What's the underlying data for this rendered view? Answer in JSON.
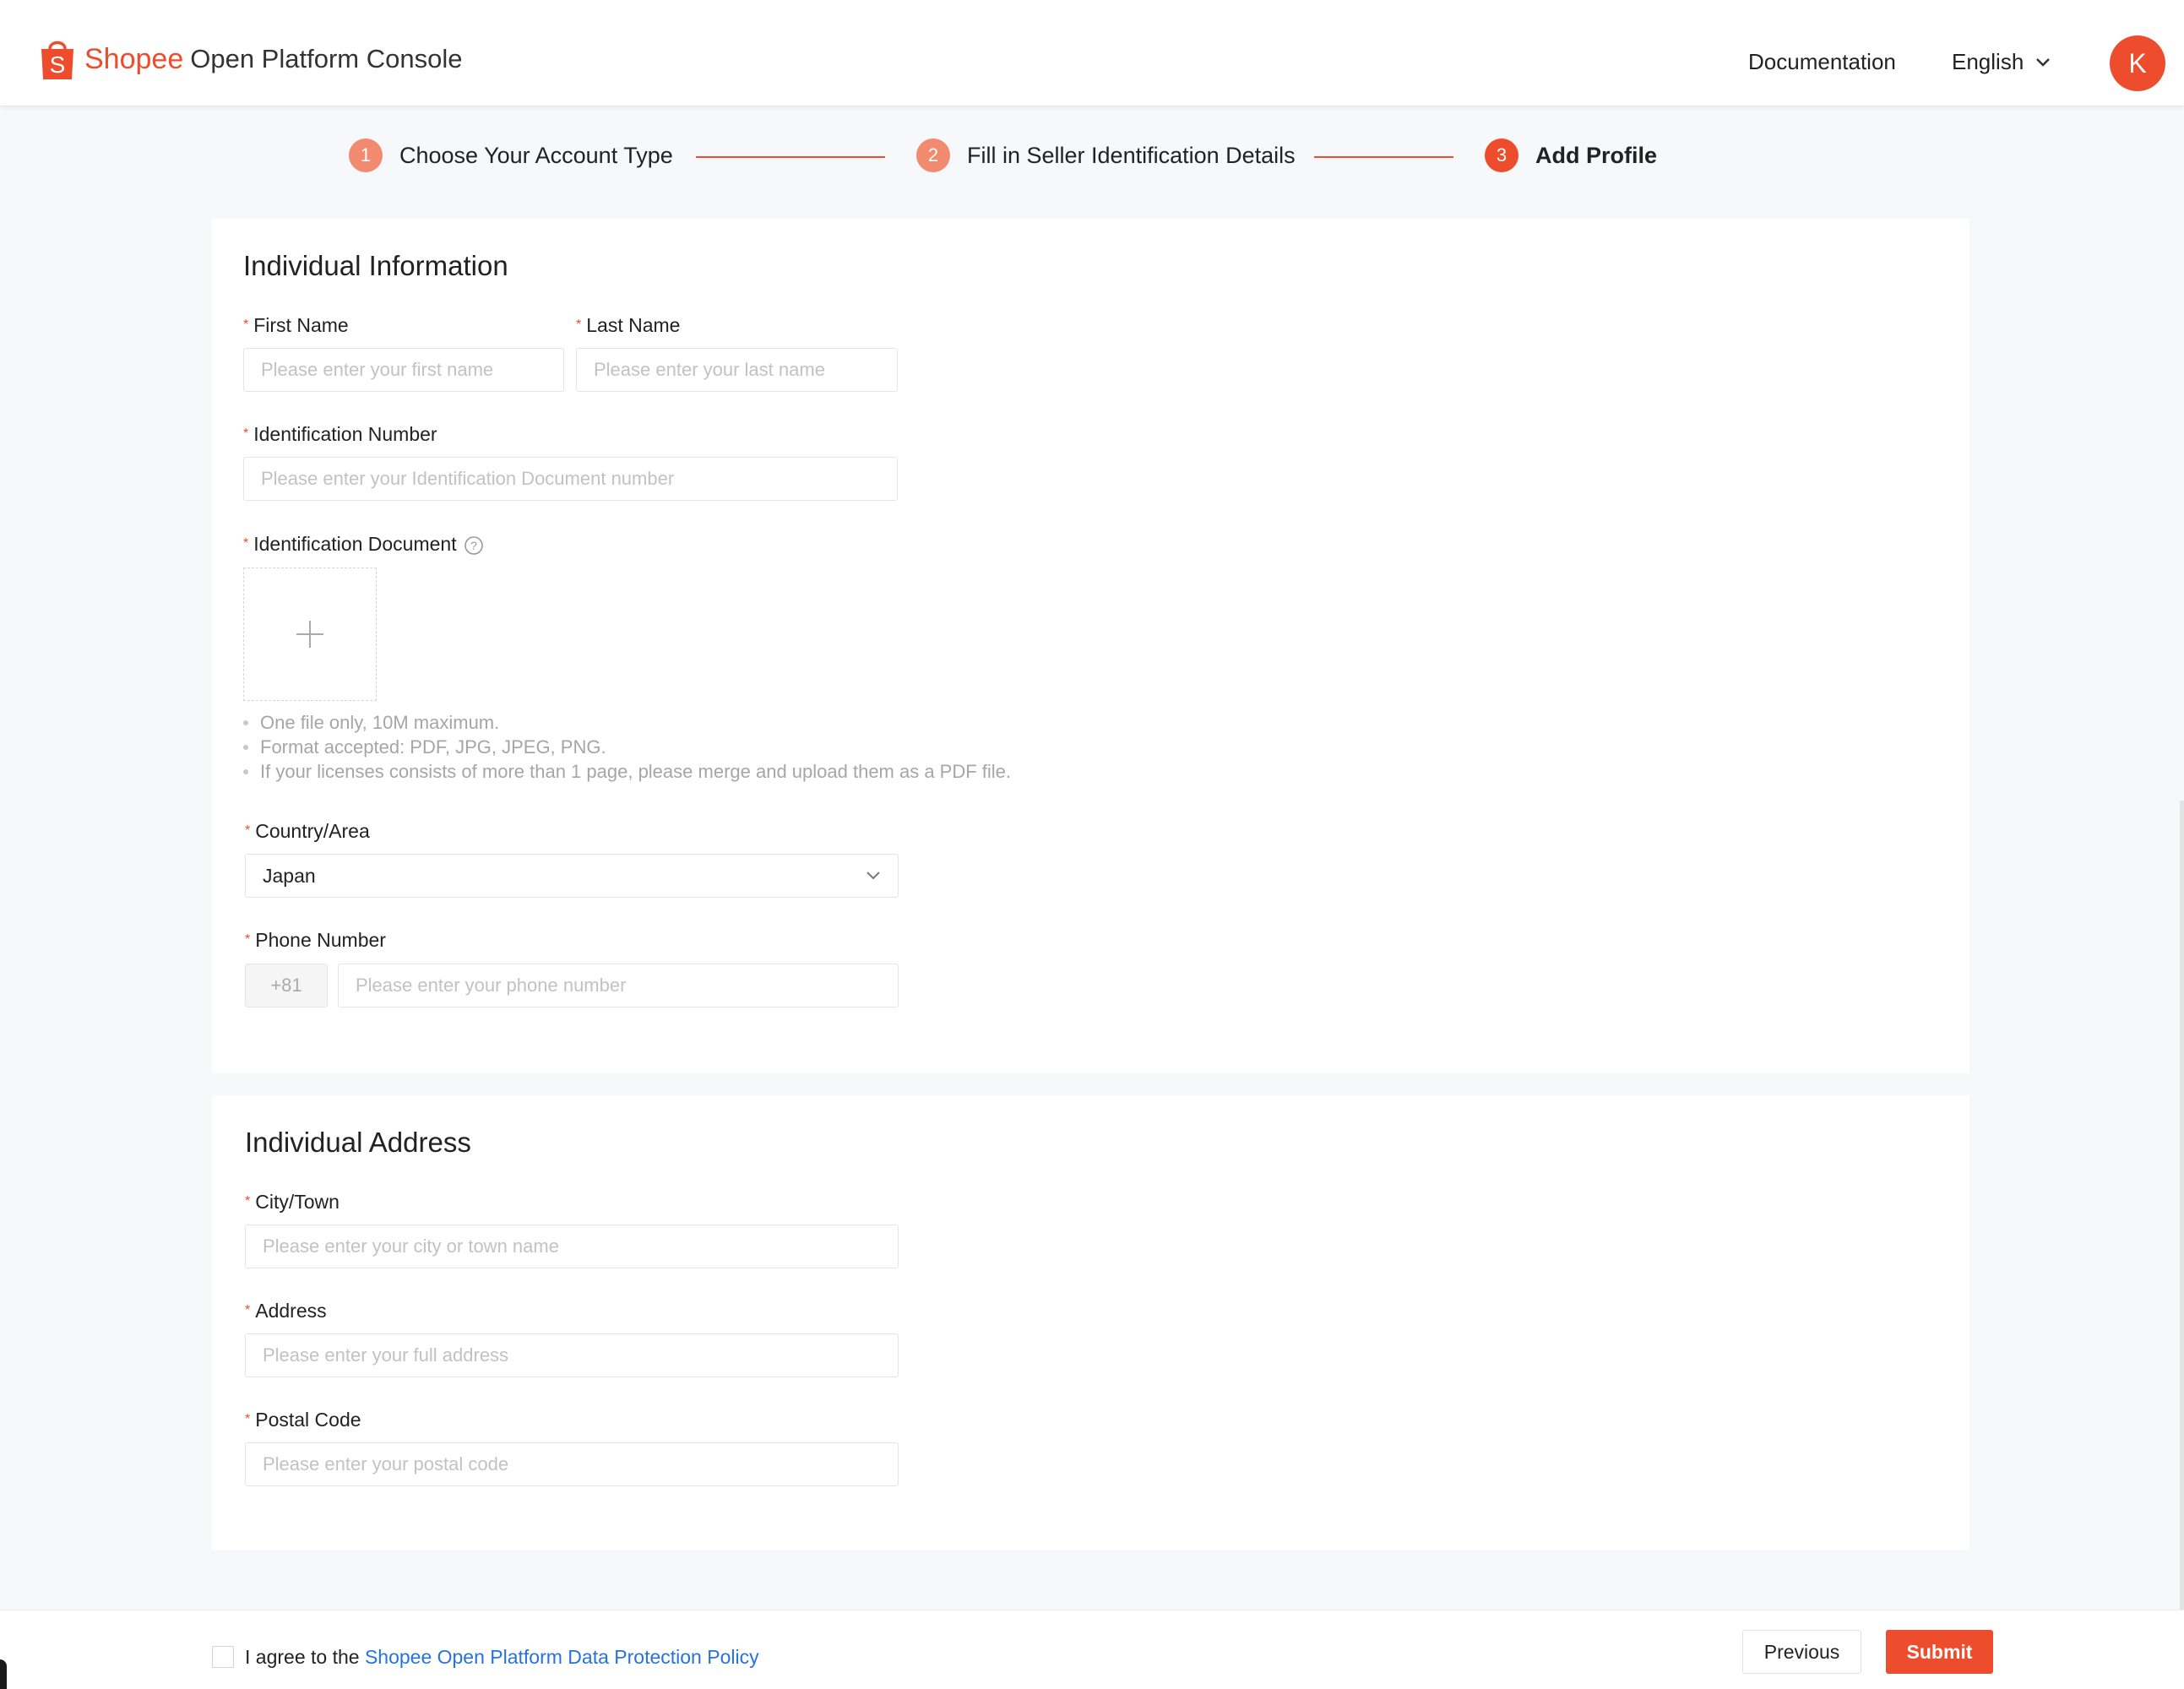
{
  "header": {
    "brand": "Shopee",
    "product": "Open Platform Console",
    "documentation": "Documentation",
    "language": "English",
    "avatar_initial": "K"
  },
  "stepper": {
    "steps": [
      {
        "number": "1",
        "label": "Choose Your Account Type"
      },
      {
        "number": "2",
        "label": "Fill in Seller Identification Details"
      },
      {
        "number": "3",
        "label": "Add Profile"
      }
    ],
    "current_step": 3
  },
  "individual_information": {
    "title": "Individual Information",
    "first_name": {
      "label": "First Name",
      "placeholder": "Please enter your first name",
      "value": ""
    },
    "last_name": {
      "label": "Last Name",
      "placeholder": "Please enter your last name",
      "value": ""
    },
    "id_number": {
      "label": "Identification Number",
      "placeholder": "Please enter your Identification Document number",
      "value": ""
    },
    "id_document": {
      "label": "Identification Document",
      "hints": [
        "One file only, 10M maximum.",
        "Format accepted: PDF, JPG, JPEG, PNG.",
        "If your licenses consists of more than 1 page, please merge and upload them as a PDF file."
      ]
    },
    "country": {
      "label": "Country/Area",
      "value": "Japan"
    },
    "phone": {
      "label": "Phone Number",
      "prefix": "+81",
      "placeholder": "Please enter your phone number",
      "value": ""
    }
  },
  "individual_address": {
    "title": "Individual Address",
    "city": {
      "label": "City/Town",
      "placeholder": "Please enter your city or town name",
      "value": ""
    },
    "address": {
      "label": "Address",
      "placeholder": "Please enter your full address",
      "value": ""
    },
    "postal_code": {
      "label": "Postal Code",
      "placeholder": "Please enter your postal code",
      "value": ""
    }
  },
  "footer": {
    "agree_text": "I agree to the",
    "policy_link": "Shopee Open Platform Data Protection Policy",
    "previous": "Previous",
    "submit": "Submit"
  },
  "colors": {
    "brand": "#ee4d2d",
    "link": "#2673dd",
    "background": "#f7f8fa"
  }
}
